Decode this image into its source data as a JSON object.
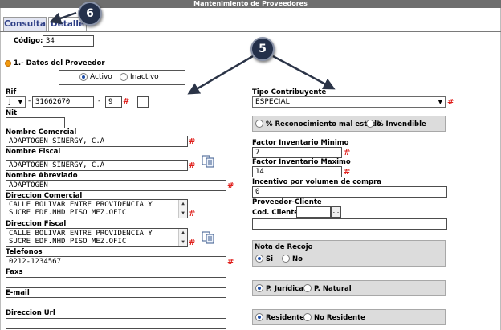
{
  "window": {
    "title": "Mantenimiento de Proveedores"
  },
  "tabs": [
    {
      "label": "Consulta"
    },
    {
      "label": "Detalle"
    }
  ],
  "codigo": {
    "label": "Código:",
    "value": "34"
  },
  "section": {
    "title": "1.- Datos del Proveedor"
  },
  "estado": {
    "options": [
      "Activo",
      "Inactivo"
    ],
    "selected": "Activo"
  },
  "rif": {
    "label": "Rif",
    "type": "J",
    "number": "31662670",
    "digit": "9",
    "dash": "-"
  },
  "nit": {
    "label": "Nit",
    "value": ""
  },
  "nombre_comercial": {
    "label": "Nombre Comercial",
    "value": "ADAPTOGEN SINERGY, C.A"
  },
  "nombre_fiscal": {
    "label": "Nombre Fiscal",
    "value": "ADAPTOGEN SINERGY, C.A"
  },
  "nombre_abreviado": {
    "label": "Nombre Abreviado",
    "value": "ADAPTOGEN"
  },
  "direccion_comercial": {
    "label": "Direccion Comercial",
    "line1": "CALLE BOLIVAR ENTRE PROVIDENCIA Y",
    "line2": "SUCRE EDF.NHD PISO MEZ.OFIC"
  },
  "direccion_fiscal": {
    "label": "Direccion Fiscal",
    "line1": "CALLE BOLIVAR ENTRE PROVIDENCIA Y",
    "line2": "SUCRE EDF.NHD PISO MEZ.OFIC"
  },
  "telefonos": {
    "label": "Telefonos",
    "value": "0212-1234567"
  },
  "faxs": {
    "label": "Faxs",
    "value": ""
  },
  "email": {
    "label": "E-mail",
    "value": ""
  },
  "direccion_url": {
    "label": "Direccion Url",
    "value": ""
  },
  "tipo_contribuyente": {
    "label": "Tipo Contribuyente",
    "value": "ESPECIAL"
  },
  "reconocimiento": {
    "options": [
      "% Reconocimiento mal estado",
      "% Invendible"
    ]
  },
  "factor_minimo": {
    "label": "Factor Inventario Minimo",
    "value": "7"
  },
  "factor_maximo": {
    "label": "Factor Inventario Maximo",
    "value": "14"
  },
  "incentivo": {
    "label": "Incentivo por volumen de compra",
    "value": "0"
  },
  "proveedor_cliente": {
    "label": "Proveedor-Cliente",
    "cod_label": "Cod. Cliente",
    "cod_value": "",
    "lookup": "...",
    "name_value": ""
  },
  "nota_recojo": {
    "label": "Nota de Recojo",
    "options": [
      "Si",
      "No"
    ],
    "selected": "Si"
  },
  "persona": {
    "options": [
      "P. Jurídica",
      "P. Natural"
    ],
    "selected": "P. Jurídica"
  },
  "residencia": {
    "options": [
      "Residente",
      "No Residente"
    ],
    "selected": "Residente"
  },
  "required_mark": "#",
  "callouts": [
    "6",
    "5"
  ],
  "colors": {
    "accent": "#2e3f86",
    "required": "#e0201c",
    "titlebar": "#6e6e6e",
    "panel": "#dcdcdc",
    "callout": "#24304a"
  },
  "icons": {
    "bullet": "orange-bullet-icon",
    "copy": "copy-documents-icon",
    "dropdown": "chevron-down-icon",
    "scroll": "scroll-arrow-icon"
  }
}
